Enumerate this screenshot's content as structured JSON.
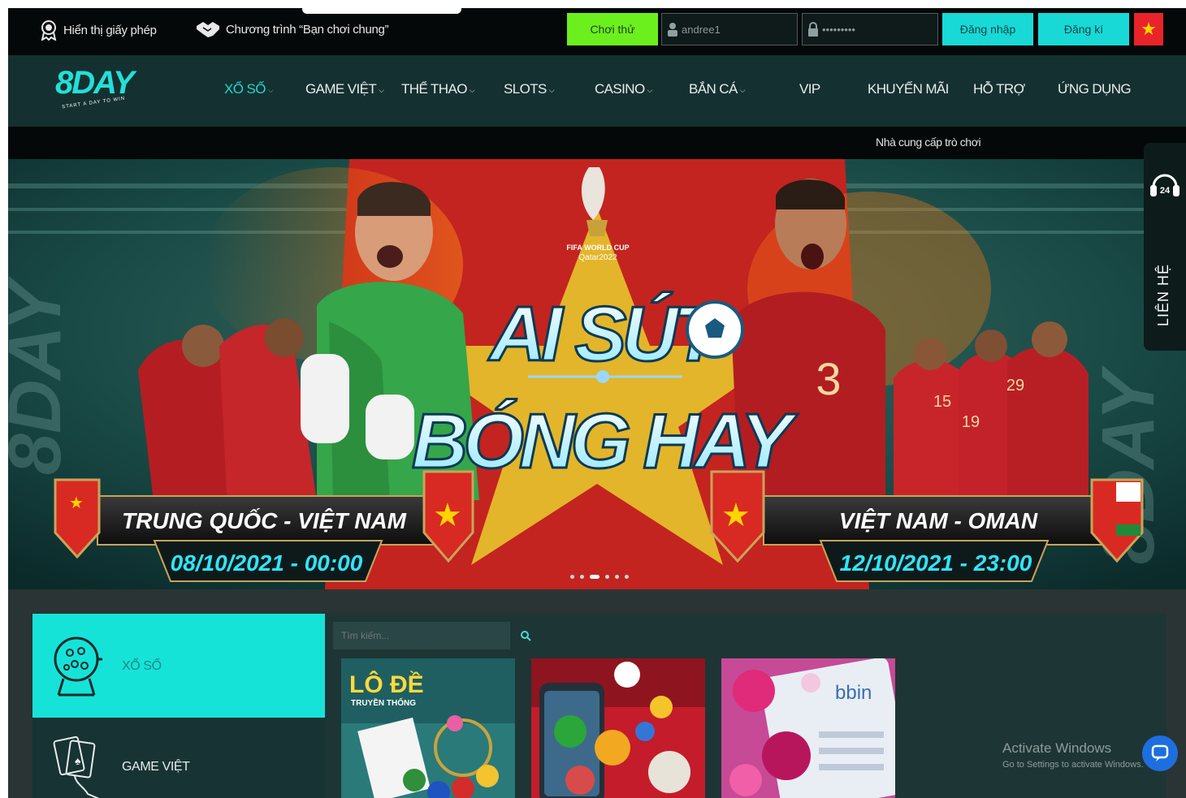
{
  "topbar": {
    "license_label": "Hiển thị giấy phép",
    "program_label": "Chương trình “Bạn chơi chung”",
    "try_button": "Chơi thử",
    "username_value": "andree1",
    "password_value": "•••••••••",
    "login_button": "Đăng nhập",
    "register_button": "Đăng kí",
    "language_flag": "★"
  },
  "logo": {
    "text": "8DAY",
    "tagline": "START A DAY TO WIN"
  },
  "nav": {
    "items": [
      {
        "label": "XỔ SỐ",
        "chevron": "⌵"
      },
      {
        "label": "GAME VIỆT",
        "chevron": "⌵"
      },
      {
        "label": "THỂ THAO",
        "chevron": "⌵"
      },
      {
        "label": "SLOTS",
        "chevron": "⌵"
      },
      {
        "label": "CASINO",
        "chevron": "⌵"
      },
      {
        "label": "BẮN CÁ",
        "chevron": "⌵"
      },
      {
        "label": "VIP"
      },
      {
        "label": "KHUYẾN MÃI"
      },
      {
        "label": "HỖ TRỢ"
      },
      {
        "label": "ỨNG DỤNG"
      }
    ]
  },
  "strip": {
    "provider_text": "Nhà cung cấp trò chơi"
  },
  "banner": {
    "event_line1": "FIFA WORLD CUP",
    "event_line2": "Qatar2022",
    "headline_1": "AI SÚT",
    "headline_2": "BÓNG HAY",
    "brand_watermark": "8DAY",
    "match_left": {
      "teams": "TRUNG QUỐC - VIỆT NAM",
      "datetime": "08/10/2021 - 00:00"
    },
    "match_right": {
      "teams": "VIỆT NAM -  OMAN",
      "datetime": "12/10/2021 - 23:00"
    },
    "player_numbers": [
      "3",
      "15",
      "19",
      "29"
    ],
    "slide_count": 6,
    "active_slide": 3
  },
  "contact": {
    "label": "LIÊN HỆ",
    "hours": "24"
  },
  "sidebar": {
    "items": [
      {
        "label": "XỔ SỐ",
        "active": true
      },
      {
        "label": "GAME VIỆT",
        "active": false
      }
    ]
  },
  "search": {
    "placeholder": "Tìm kiếm..."
  },
  "games": [
    {
      "title": "LÔ ĐỀ",
      "subtitle": "TRUYỀN THỐNG"
    },
    {
      "title": ""
    },
    {
      "title": "bbin"
    }
  ],
  "windows_notice": {
    "line1": "Activate Windows",
    "line2": "Go to Settings to activate Windows."
  },
  "colors": {
    "accent": "#18d9d6",
    "try": "#6bf01e",
    "dark": "#050808",
    "nav": "#153030"
  }
}
